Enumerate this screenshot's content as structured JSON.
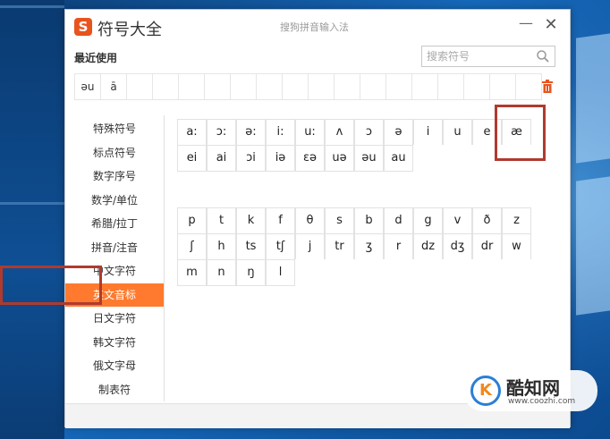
{
  "window": {
    "logo_letter": "S",
    "app_title": "符号大全",
    "ime_name": "搜狗拼音输入法",
    "minimize_label": "—",
    "close_label": "✕"
  },
  "recent": {
    "label": "最近使用",
    "items": [
      "əu",
      "ā",
      "",
      "",
      "",
      "",
      "",
      "",
      "",
      "",
      "",
      "",
      "",
      "",
      "",
      "",
      "",
      ""
    ]
  },
  "search": {
    "placeholder": "搜索符号"
  },
  "sidebar": {
    "items": [
      {
        "label": "特殊符号"
      },
      {
        "label": "标点符号"
      },
      {
        "label": "数字序号"
      },
      {
        "label": "数学/单位"
      },
      {
        "label": "希腊/拉丁"
      },
      {
        "label": "拼音/注音"
      },
      {
        "label": "中文字符"
      },
      {
        "label": "英文音标"
      },
      {
        "label": "日文字符"
      },
      {
        "label": "韩文字符"
      },
      {
        "label": "俄文字母"
      },
      {
        "label": "制表符"
      }
    ],
    "active_index": 7
  },
  "vowels": {
    "row1": [
      "a:",
      "ɔ:",
      "ə:",
      "i:",
      "u:",
      "ʌ",
      "ɔ",
      "ə",
      "i",
      "u",
      "e",
      "æ"
    ],
    "row2": [
      "ei",
      "ai",
      "ɔi",
      "iə",
      "ɛə",
      "uə",
      "əu",
      "au"
    ]
  },
  "consonants": {
    "row1": [
      "p",
      "t",
      "k",
      "f",
      "θ",
      "s",
      "b",
      "d",
      "g",
      "v",
      "ð",
      "z"
    ],
    "row2": [
      "ʃ",
      "h",
      "ts",
      "tʃ",
      "j",
      "tr",
      "ʒ",
      "r",
      "dz",
      "dʒ",
      "dr",
      "w"
    ],
    "row3": [
      "m",
      "n",
      "ŋ",
      "l"
    ]
  },
  "watermark": {
    "logo_letter": "K",
    "name": "酷知网",
    "url": "www.coozhi.com"
  },
  "colors": {
    "accent": "#ff7a2e",
    "highlight": "#b03a2e",
    "logo": "#e8541e"
  }
}
